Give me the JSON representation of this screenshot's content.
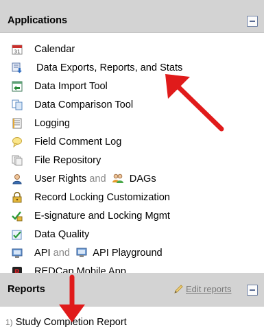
{
  "applications": {
    "title": "Applications",
    "items": [
      {
        "label": "Calendar",
        "icon": "calendar-icon"
      },
      {
        "label": "Data Exports, Reports, and Stats",
        "icon": "data-exports-icon"
      },
      {
        "label": "Data Import Tool",
        "icon": "data-import-icon"
      },
      {
        "label": "Data Comparison Tool",
        "icon": "data-comparison-icon"
      },
      {
        "label": "Logging",
        "icon": "logging-icon"
      },
      {
        "label": "Field Comment Log",
        "icon": "field-comment-icon"
      },
      {
        "label": "File Repository",
        "icon": "file-repository-icon"
      },
      {
        "label_a": "User Rights",
        "sep": "and",
        "label_b": "DAGs",
        "icon": "user-rights-icon",
        "icon_b": "dags-icon"
      },
      {
        "label": "Record Locking Customization",
        "icon": "record-locking-icon"
      },
      {
        "label": "E-signature and Locking Mgmt",
        "icon": "esignature-icon"
      },
      {
        "label": "Data Quality",
        "icon": "data-quality-icon"
      },
      {
        "label_a": "API",
        "sep": "and",
        "label_b": "API Playground",
        "icon": "api-icon",
        "icon_b": "api-playground-icon"
      },
      {
        "label": "REDCap Mobile App",
        "icon": "mobile-app-icon"
      }
    ]
  },
  "reports": {
    "title": "Reports",
    "edit_label": "Edit reports",
    "items": [
      {
        "number": "1)",
        "label": "Study Completion Report"
      }
    ]
  },
  "annotations": {
    "arrow_color": "#e01b1b"
  }
}
